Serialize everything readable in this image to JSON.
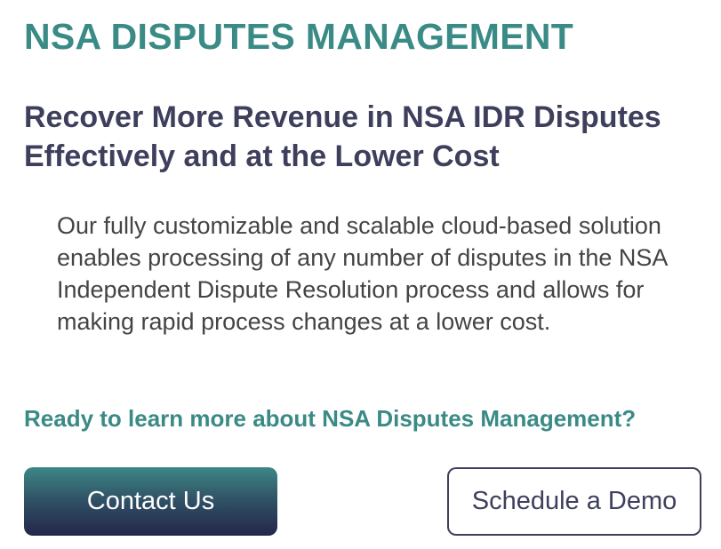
{
  "header": {
    "title": "NSA DISPUTES MANAGEMENT",
    "subtitle": "Recover More Revenue in NSA IDR Disputes Effectively and at the Lower Cost"
  },
  "main": {
    "description": "Our fully customizable and scalable cloud-based solution enables processing of any number of disputes in the NSA Independent Dispute Resolution process and allows for making rapid process changes at a lower cost.",
    "cta_question": "Ready to learn more about NSA Disputes Management?"
  },
  "actions": {
    "contact_label": "Contact Us",
    "demo_label": "Schedule a Demo"
  },
  "colors": {
    "accent_teal": "#3a8a86",
    "heading_navy": "#3e3f5c",
    "button_gradient_top": "#3d8785",
    "button_gradient_bottom": "#24264a"
  }
}
